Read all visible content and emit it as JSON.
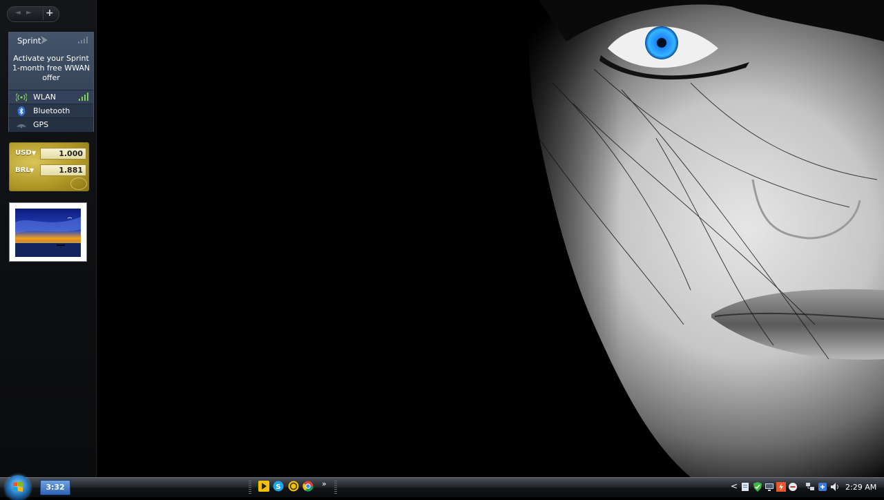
{
  "sidebar": {
    "nav_prev": "◄",
    "nav_next": "►",
    "add": "+"
  },
  "sprint_gadget": {
    "title": "Sprint",
    "message": "Activate your Sprint 1-month free WWAN offer",
    "rows": [
      {
        "label": "WLAN",
        "icon": "wifi-icon"
      },
      {
        "label": "Bluetooth",
        "icon": "bluetooth-icon"
      },
      {
        "label": "GPS",
        "icon": "gps-icon"
      }
    ]
  },
  "currency_gadget": {
    "from_code": "USD",
    "from_value": "1.000",
    "to_code": "BRL",
    "to_value": "1.881",
    "caret": "▼"
  },
  "slideshow_gadget": {
    "image": "sunset-sea-photo"
  },
  "taskbar": {
    "start_icon": "windows-start-orb",
    "task_button_label": "3:32",
    "quick_launch": [
      "media-player-icon",
      "skype-icon",
      "norton-icon",
      "chrome-icon"
    ],
    "quick_launch_more": "»",
    "tray_chevron": "<",
    "tray_icons": [
      "document-icon",
      "shield-icon",
      "monitor-icon",
      "flash-icon",
      "minus-icon",
      "network-icon",
      "connect-icon",
      "volume-icon"
    ],
    "clock": "2:29 AM"
  },
  "colors": {
    "iris": "#2aa0ff",
    "sidebar": "#121417",
    "sprint_panel": "#3b4a60",
    "gold": "#b39a28"
  }
}
